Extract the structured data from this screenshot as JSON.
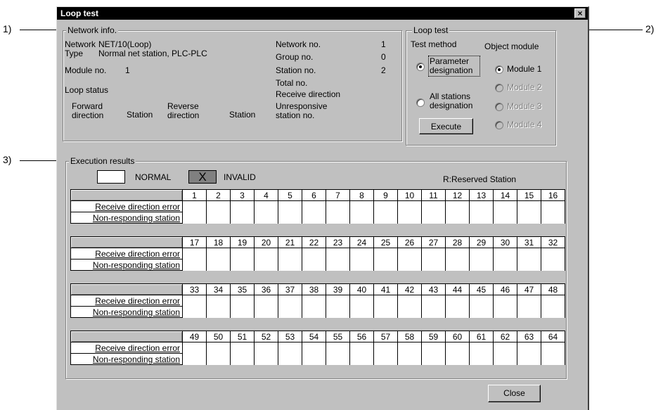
{
  "callouts": {
    "c1": "1)",
    "c2": "2)",
    "c3": "3)"
  },
  "window": {
    "title": "Loop test",
    "close_glyph": "×"
  },
  "network_info": {
    "legend": "Network info.",
    "network_label": "Network",
    "network_value": "NET/10(Loop)",
    "type_label": "Type",
    "type_value": "Normal net station, PLC-PLC",
    "module_no_label": "Module no.",
    "module_no_value": "1",
    "loop_status": "Loop status",
    "forward_direction": "Forward direction",
    "station1": "Station",
    "reverse_direction": "Reverse direction",
    "station2": "Station",
    "network_no_label": "Network no.",
    "network_no_value": "1",
    "group_no_label": "Group no.",
    "group_no_value": "0",
    "station_no_label": "Station no.",
    "station_no_value": "2",
    "total_no_label": "Total no.",
    "receive_direction_label": "Receive direction",
    "unresponsive_label": "Unresponsive station no."
  },
  "loop_test": {
    "legend": "Loop test",
    "test_method_label": "Test method",
    "object_module_label": "Object module",
    "methods": [
      {
        "label": "Parameter designation",
        "selected": true
      },
      {
        "label": "All stations designation",
        "selected": false
      }
    ],
    "modules": [
      {
        "label": "Module 1",
        "selected": true,
        "enabled": true
      },
      {
        "label": "Module 2",
        "selected": false,
        "enabled": false
      },
      {
        "label": "Module 3",
        "selected": false,
        "enabled": false
      },
      {
        "label": "Module 4",
        "selected": false,
        "enabled": false
      }
    ],
    "execute_label": "Execute"
  },
  "execution_results": {
    "legend": "Execution results",
    "normal_label": "NORMAL",
    "invalid_label": "INVALID",
    "invalid_glyph": "X",
    "reserved_label": "R:Reserved Station",
    "row_labels": [
      "Receive direction error",
      "Non-responding station"
    ],
    "blocks": [
      [
        1,
        2,
        3,
        4,
        5,
        6,
        7,
        8,
        9,
        10,
        11,
        12,
        13,
        14,
        15,
        16
      ],
      [
        17,
        18,
        19,
        20,
        21,
        22,
        23,
        24,
        25,
        26,
        27,
        28,
        29,
        30,
        31,
        32
      ],
      [
        33,
        34,
        35,
        36,
        37,
        38,
        39,
        40,
        41,
        42,
        43,
        44,
        45,
        46,
        47,
        48
      ],
      [
        49,
        50,
        51,
        52,
        53,
        54,
        55,
        56,
        57,
        58,
        59,
        60,
        61,
        62,
        63,
        64
      ]
    ]
  },
  "close_button_label": "Close"
}
